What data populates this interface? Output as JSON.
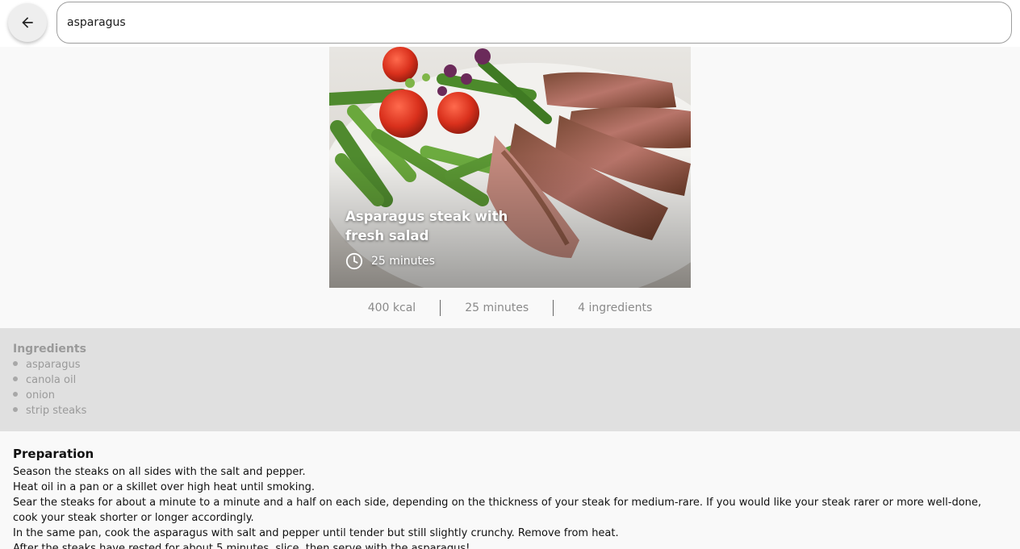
{
  "search": {
    "value": "asparagus",
    "back_icon": "arrow-left-icon"
  },
  "recipe": {
    "title": "Asparagus steak with fresh salad",
    "time": "25 minutes",
    "time_icon": "clock-icon"
  },
  "stats": {
    "kcal": "400 kcal",
    "duration": "25 minutes",
    "ingredients_count": "4 ingredients"
  },
  "ingredients": {
    "heading": "Ingredients",
    "items": [
      "asparagus",
      "canola oil",
      "onion",
      "strip steaks"
    ]
  },
  "preparation": {
    "heading": "Preparation",
    "steps": [
      "Season the steaks on all sides with the salt and pepper.",
      "Heat oil in a pan or a skillet over high heat until smoking.",
      "Sear the steaks for about a minute to a minute and a half on each side, depending on the thickness of your steak for medium-rare. If you would like your steak rarer or more well-done, cook your steak shorter or longer accordingly.",
      "In the same pan, cook the asparagus with salt and pepper until tender but still slightly crunchy. Remove from heat.",
      "After the steaks have rested for about 5 minutes, slice, then serve with the asparagus!"
    ]
  },
  "colors": {
    "page_bg": "#f9f9f9",
    "ingredients_bg": "#e0e0e0",
    "muted_text": "#9a9a9a"
  }
}
